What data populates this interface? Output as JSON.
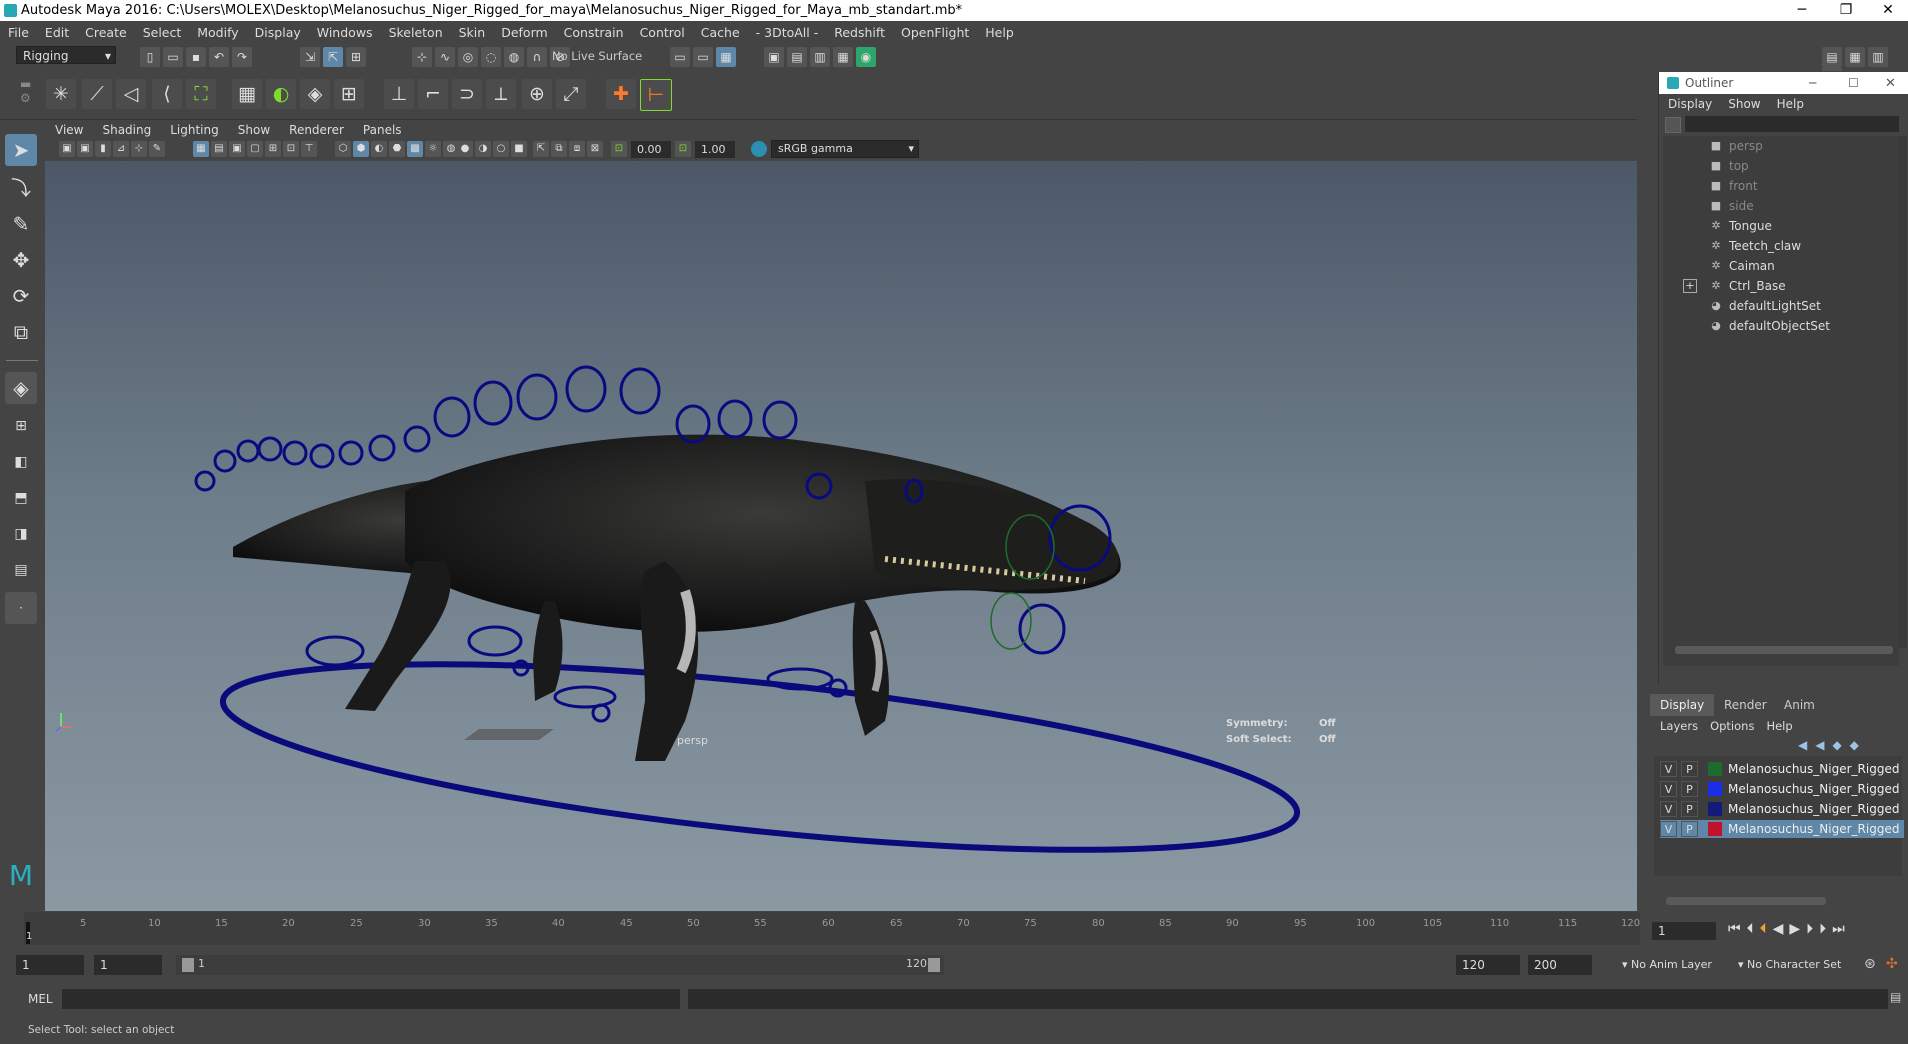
{
  "window": {
    "title": "Autodesk Maya 2016: C:\\Users\\MOLEX\\Desktop\\Melanosuchus_Niger_Rigged_for_maya\\Melanosuchus_Niger_Rigged_for_Maya_mb_standart.mb*",
    "minimize": "─",
    "restore": "❐",
    "close": "✕"
  },
  "menubar": [
    "File",
    "Edit",
    "Create",
    "Select",
    "Modify",
    "Display",
    "Windows",
    "Skeleton",
    "Skin",
    "Deform",
    "Constrain",
    "Control",
    "Cache",
    "- 3DtoAll -",
    "Redshift",
    "OpenFlight",
    "Help"
  ],
  "statusline": {
    "mode": "Rigging",
    "live_surface": "No Live Surface"
  },
  "viewport_menu": [
    "View",
    "Shading",
    "Lighting",
    "Show",
    "Renderer",
    "Panels"
  ],
  "viewport_toolbar": {
    "field1": "0.00",
    "field2": "1.00",
    "colorspace": "sRGB gamma"
  },
  "viewport": {
    "camera_label": "persp",
    "hud": {
      "symmetry_label": "Symmetry:",
      "symmetry_value": "Off",
      "soft_label": "Soft Select:",
      "soft_value": "Off"
    }
  },
  "outliner": {
    "title": "Outliner",
    "menu": [
      "Display",
      "Show",
      "Help"
    ],
    "items": [
      {
        "label": "persp",
        "icon": "camera-icon",
        "dim": true
      },
      {
        "label": "top",
        "icon": "camera-icon",
        "dim": true
      },
      {
        "label": "front",
        "icon": "camera-icon",
        "dim": true
      },
      {
        "label": "side",
        "icon": "camera-icon",
        "dim": true
      },
      {
        "label": "Tongue",
        "icon": "mesh-icon",
        "dim": false
      },
      {
        "label": "Teetch_claw",
        "icon": "mesh-icon",
        "dim": false
      },
      {
        "label": "Caiman",
        "icon": "mesh-icon",
        "dim": false
      },
      {
        "label": "Ctrl_Base",
        "icon": "mesh-icon",
        "dim": false,
        "expand": "+"
      },
      {
        "label": "defaultLightSet",
        "icon": "set-icon",
        "dim": false
      },
      {
        "label": "defaultObjectSet",
        "icon": "set-icon",
        "dim": false
      }
    ]
  },
  "layer_editor": {
    "tabs": [
      "Display",
      "Render",
      "Anim"
    ],
    "menu": [
      "Layers",
      "Options",
      "Help"
    ],
    "layers": [
      {
        "v": "V",
        "p": "P",
        "color": "#1d6b2e",
        "name": "Melanosuchus_Niger_Rigged"
      },
      {
        "v": "V",
        "p": "P",
        "color": "#1a2ee8",
        "name": "Melanosuchus_Niger_Rigged"
      },
      {
        "v": "V",
        "p": "P",
        "color": "#141a7a",
        "name": "Melanosuchus_Niger_Rigged"
      },
      {
        "v": "V",
        "p": "P",
        "color": "#c0122c",
        "name": "Melanosuchus_Niger_Rigged",
        "selected": true
      }
    ]
  },
  "timeslider": {
    "ticks": [
      "5",
      "10",
      "15",
      "20",
      "25",
      "30",
      "35",
      "40",
      "45",
      "50",
      "55",
      "60",
      "65",
      "70",
      "75",
      "80",
      "85",
      "90",
      "95",
      "100",
      "105",
      "110",
      "115",
      "120"
    ],
    "start_tick": "1",
    "current_frame": "1"
  },
  "rangebar": {
    "start": "1",
    "playback_start": "1",
    "range_start": "1",
    "range_end": "120",
    "playback_end": "120",
    "end": "200",
    "anim_layer": "No Anim Layer",
    "character_set": "No Character Set"
  },
  "cmdline": {
    "label": "MEL"
  },
  "helpline": {
    "text": "Select Tool: select an object"
  }
}
